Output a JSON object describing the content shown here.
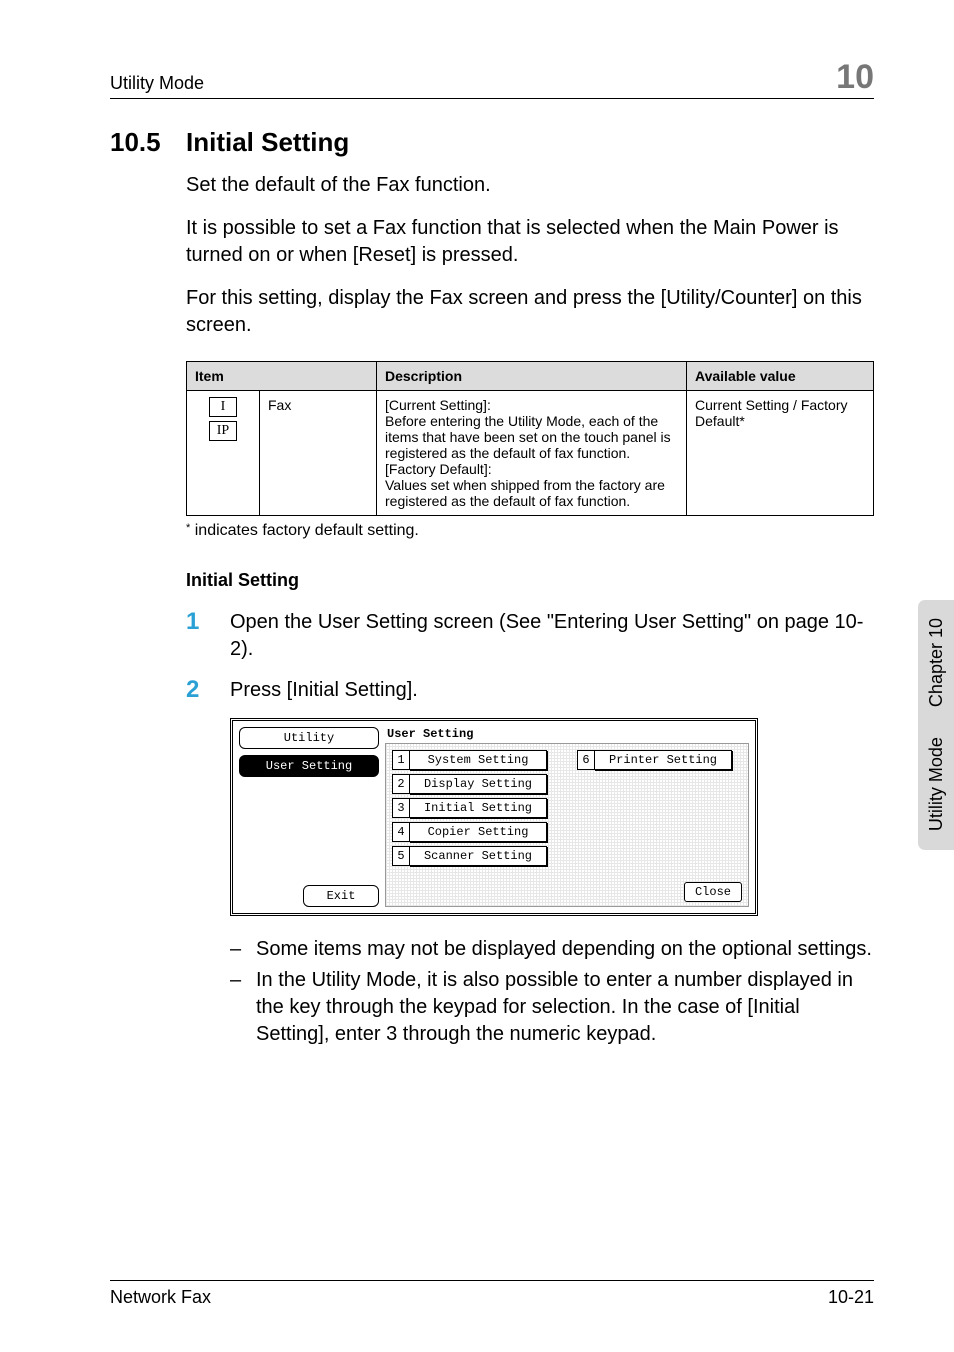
{
  "header": {
    "left": "Utility Mode",
    "chapter_number": "10"
  },
  "section": {
    "number": "10.5",
    "title": "Initial Setting"
  },
  "paragraphs": {
    "p1": "Set the default of the Fax function.",
    "p2": "It is possible to set a Fax function that is selected when the Main Power is turned on or when [Reset] is pressed.",
    "p3": "For this setting, display the Fax screen and press the [Utility/Counter] on this screen."
  },
  "table": {
    "head": {
      "item": "Item",
      "desc": "Description",
      "avail": "Available value"
    },
    "row": {
      "icons": {
        "a": "I",
        "b": "IP"
      },
      "item": "Fax",
      "desc": "[Current Setting]:\nBefore entering the Utility Mode, each of the items that have been set on the touch panel is registered as the default of fax function.\n[Factory Default]:\nValues set when shipped from the factory are registered as the default of fax function.",
      "avail": "Current Setting / Factory Default*"
    }
  },
  "footnote": "indicates factory default setting.",
  "subhead": "Initial Setting",
  "steps": {
    "s1": {
      "n": "1",
      "t": "Open the User Setting screen (See \"Entering User Setting\" on page 10-2)."
    },
    "s2": {
      "n": "2",
      "t": "Press [Initial Setting]."
    }
  },
  "screenshot": {
    "title": "User Setting",
    "side": {
      "utility": "Utility",
      "userSetting": "User Setting",
      "exit": "Exit"
    },
    "items": {
      "n1": "1",
      "l1": "System Setting",
      "n2": "2",
      "l2": "Display Setting",
      "n3": "3",
      "l3": "Initial Setting",
      "n4": "4",
      "l4": "Copier Setting",
      "n5": "5",
      "l5": "Scanner Setting",
      "n6": "6",
      "l6": "Printer Setting"
    },
    "close": "Close"
  },
  "bullets": {
    "b1": "Some items may not be displayed depending on the optional settings.",
    "b2": "In the Utility Mode, it is also possible to enter a number displayed in the key through the keypad for selection. In the case of [Initial Setting], enter 3 through the numeric keypad."
  },
  "sidetab": {
    "top": "Chapter 10",
    "bottom": "Utility Mode"
  },
  "footer": {
    "left": "Network Fax",
    "right": "10-21"
  }
}
